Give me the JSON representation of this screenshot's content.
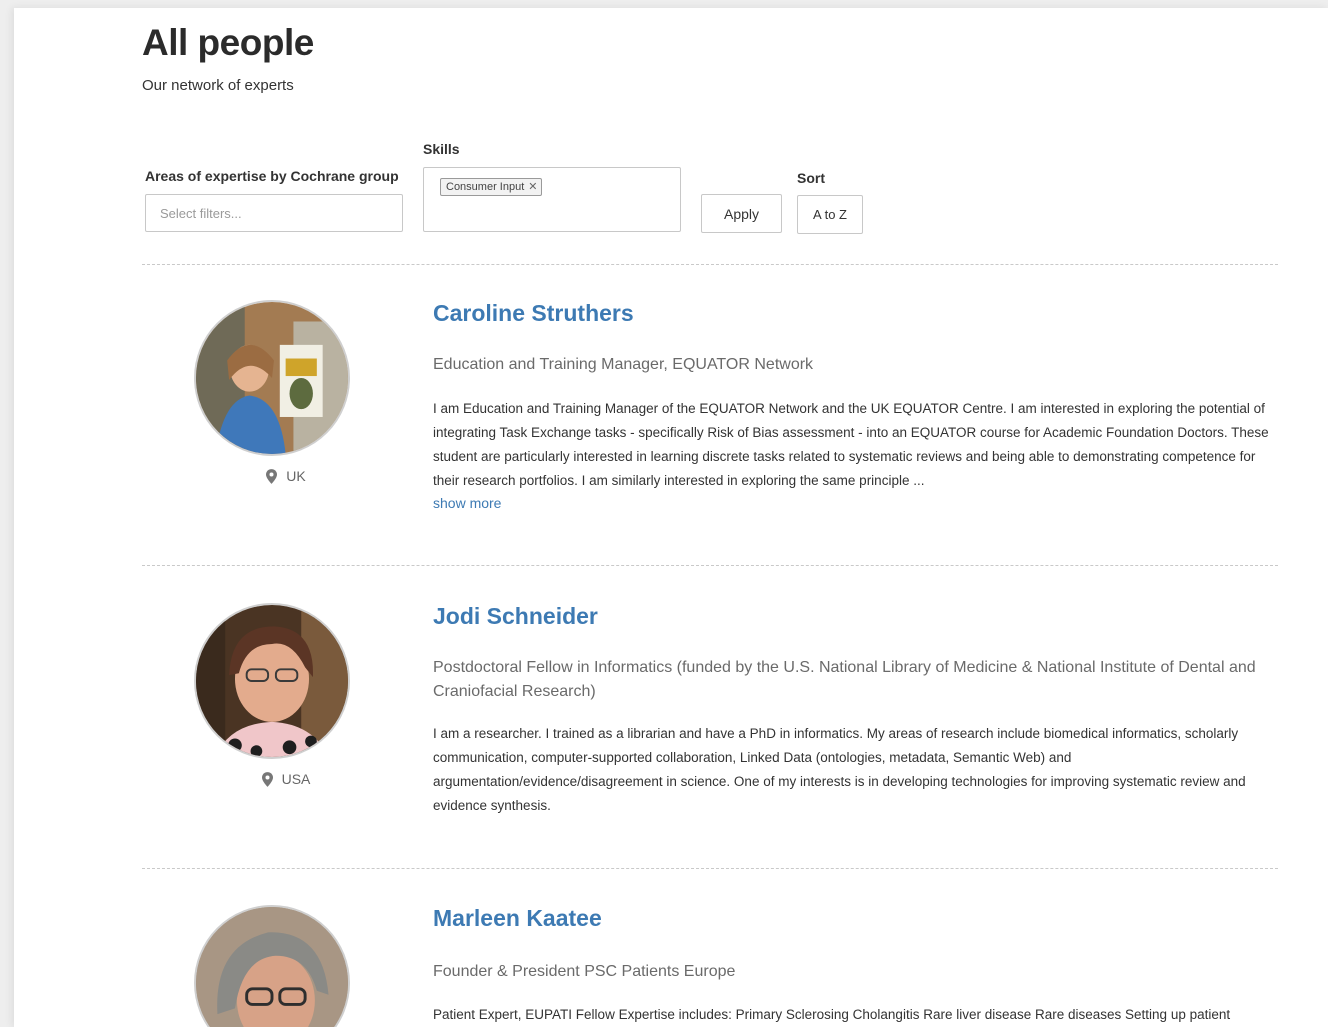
{
  "header": {
    "title": "All people",
    "subtitle": "Our network of experts"
  },
  "filters": {
    "areas_label": "Areas of expertise by Cochrane group",
    "areas_placeholder": "Select filters...",
    "skills_label": "Skills",
    "skills_selected": [
      {
        "label": "Consumer Input",
        "remove_icon": "close-icon"
      }
    ],
    "apply_label": "Apply",
    "sort_label": "Sort",
    "sort_value": "A to Z"
  },
  "people": [
    {
      "name": "Caroline Struthers",
      "role": "Education and Training Manager, EQUATOR Network",
      "bio": "I am Education and Training Manager of the EQUATOR Network and the UK EQUATOR Centre. I am interested in exploring the potential of integrating Task Exchange tasks - specifically Risk of Bias assessment - into an EQUATOR course for Academic Foundation Doctors. These student are particularly interested in learning discrete tasks related to systematic reviews and being able to demonstrating competence for their research portfolios. I am similarly interested in exploring the same principle ...",
      "show_more": "show more",
      "location": "UK",
      "location_icon": "map-pin-icon"
    },
    {
      "name": "Jodi Schneider",
      "role": "Postdoctoral Fellow in Informatics (funded by the U.S. National Library of Medicine & National Institute of Dental and Craniofacial Research)",
      "bio": "I am a researcher. I trained as a librarian and have a PhD in informatics. My areas of research include biomedical informatics, scholarly communication, computer-supported collaboration, Linked Data (ontologies, metadata, Semantic Web) and argumentation/evidence/disagreement in science. One of my interests is in developing technologies for improving systematic review and evidence synthesis.",
      "location": "USA",
      "location_icon": "map-pin-icon"
    },
    {
      "name": "Marleen Kaatee",
      "role": "Founder & President PSC Patients Europe",
      "bio": "Patient Expert, EUPATI Fellow Expertise includes: Primary Sclerosing Cholangitis Rare liver disease Rare diseases Setting up patient organisations"
    }
  ],
  "colors": {
    "link": "#3d7ab3",
    "divider": "#c9c9c9",
    "background": "#eeeeee"
  }
}
